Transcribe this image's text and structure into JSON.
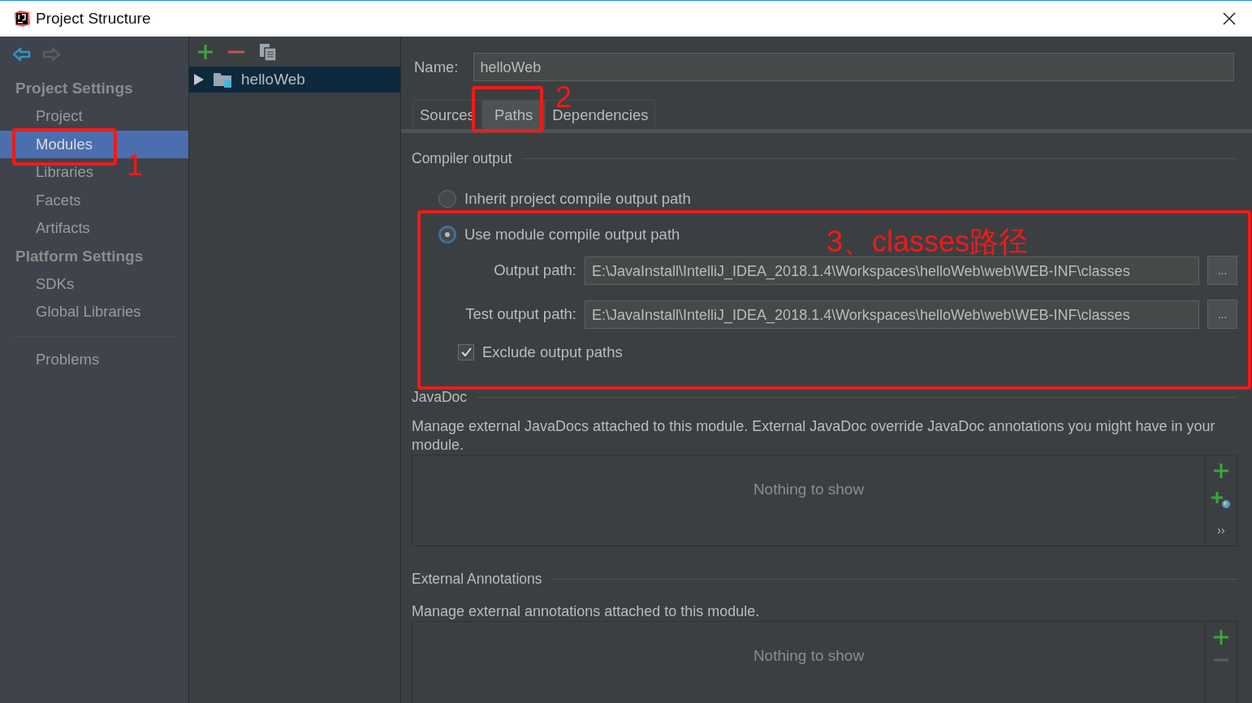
{
  "window": {
    "title": "Project Structure"
  },
  "sidebar": {
    "sections": [
      {
        "heading": "Project Settings",
        "items": [
          {
            "label": "Project",
            "selected": false
          },
          {
            "label": "Modules",
            "selected": true
          },
          {
            "label": "Libraries",
            "selected": false
          },
          {
            "label": "Facets",
            "selected": false
          },
          {
            "label": "Artifacts",
            "selected": false
          }
        ]
      },
      {
        "heading": "Platform Settings",
        "items": [
          {
            "label": "SDKs",
            "selected": false
          },
          {
            "label": "Global Libraries",
            "selected": false
          }
        ]
      }
    ],
    "bottom_items": [
      {
        "label": "Problems",
        "selected": false
      }
    ]
  },
  "module_tree": {
    "items": [
      {
        "label": "helloWeb",
        "selected": true,
        "expanded": false
      }
    ]
  },
  "name_field": {
    "label": "Name:",
    "value": "helloWeb"
  },
  "tabs": [
    {
      "label": "Sources",
      "selected": false
    },
    {
      "label": "Paths",
      "selected": true
    },
    {
      "label": "Dependencies",
      "selected": false
    }
  ],
  "compiler_output": {
    "title": "Compiler output",
    "options": [
      {
        "label": "Inherit project compile output path",
        "selected": false
      },
      {
        "label": "Use module compile output path",
        "selected": true
      }
    ],
    "paths": [
      {
        "label": "Output path:",
        "value": "E:\\JavaInstall\\IntelliJ_IDEA_2018.1.4\\Workspaces\\helloWeb\\web\\WEB-INF\\classes",
        "button": "..."
      },
      {
        "label": "Test output path:",
        "value": "E:\\JavaInstall\\IntelliJ_IDEA_2018.1.4\\Workspaces\\helloWeb\\web\\WEB-INF\\classes",
        "button": "..."
      }
    ],
    "exclude": {
      "label": "Exclude output paths",
      "checked": true
    }
  },
  "javadoc": {
    "title": "JavaDoc",
    "description": "Manage external JavaDocs attached to this module. External JavaDoc override JavaDoc annotations you might have in your module.",
    "empty_text": "Nothing to show",
    "more": "››"
  },
  "external_annotations": {
    "title": "External Annotations",
    "description": "Manage external annotations attached to this module.",
    "empty_text": "Nothing to show"
  },
  "annotations": [
    {
      "text": "1"
    },
    {
      "text": "2"
    },
    {
      "text": "3、classes路径"
    }
  ]
}
